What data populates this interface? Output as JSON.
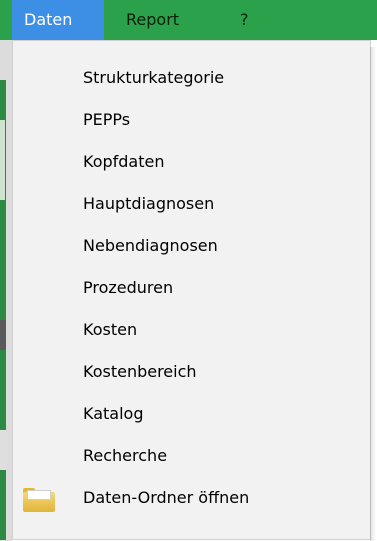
{
  "menubar": {
    "items": [
      "Daten",
      "Report",
      "?"
    ],
    "active": "Daten"
  },
  "dropdown": {
    "items": [
      {
        "label": "Strukturkategorie",
        "icon": ""
      },
      {
        "label": "PEPPs",
        "icon": ""
      },
      {
        "label": "Kopfdaten",
        "icon": ""
      },
      {
        "label": "Hauptdiagnosen",
        "icon": ""
      },
      {
        "label": "Nebendiagnosen",
        "icon": ""
      },
      {
        "label": "Prozeduren",
        "icon": ""
      },
      {
        "label": "Kosten",
        "icon": ""
      },
      {
        "label": "Kostenbereich",
        "icon": ""
      },
      {
        "label": "Katalog",
        "icon": ""
      },
      {
        "label": "Recherche",
        "icon": ""
      },
      {
        "label": "Daten-Ordner öffnen",
        "icon": "folder-icon"
      }
    ]
  },
  "colors": {
    "menubar": "#2aa14a",
    "active_menu": "#3d8ee5",
    "dropdown_bg": "#f2f2f2"
  }
}
